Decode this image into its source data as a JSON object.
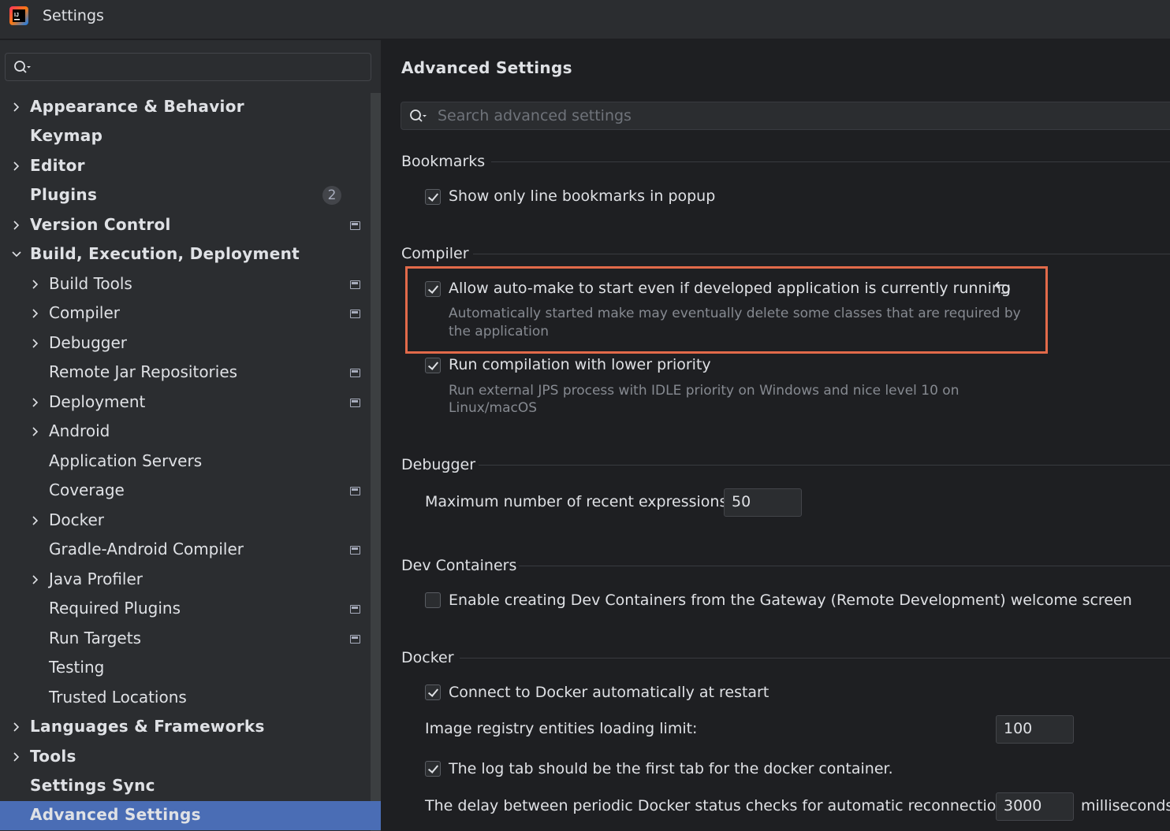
{
  "window": {
    "title": "Settings"
  },
  "sidebar": {
    "search_value": "",
    "items": [
      {
        "label": "Appearance & Behavior"
      },
      {
        "label": "Keymap"
      },
      {
        "label": "Editor"
      },
      {
        "label": "Plugins",
        "badge": "2"
      },
      {
        "label": "Version Control"
      },
      {
        "label": "Build, Execution, Deployment"
      },
      {
        "label": "Build Tools"
      },
      {
        "label": "Compiler"
      },
      {
        "label": "Debugger"
      },
      {
        "label": "Remote Jar Repositories"
      },
      {
        "label": "Deployment"
      },
      {
        "label": "Android"
      },
      {
        "label": "Application Servers"
      },
      {
        "label": "Coverage"
      },
      {
        "label": "Docker"
      },
      {
        "label": "Gradle-Android Compiler"
      },
      {
        "label": "Java Profiler"
      },
      {
        "label": "Required Plugins"
      },
      {
        "label": "Run Targets"
      },
      {
        "label": "Testing"
      },
      {
        "label": "Trusted Locations"
      },
      {
        "label": "Languages & Frameworks"
      },
      {
        "label": "Tools"
      },
      {
        "label": "Settings Sync"
      },
      {
        "label": "Advanced Settings"
      }
    ]
  },
  "main": {
    "title": "Advanced Settings",
    "search_placeholder": "Search advanced settings",
    "sections": {
      "bookmarks": {
        "title": "Bookmarks",
        "opt1": {
          "label": "Show only line bookmarks in popup",
          "checked": true
        }
      },
      "compiler": {
        "title": "Compiler",
        "opt1": {
          "label": "Allow auto-make to start even if developed application is currently running",
          "desc1": "Automatically started make may eventually delete some classes that are required by",
          "desc2": "the application",
          "checked": true
        },
        "opt2": {
          "label": "Run compilation with lower priority",
          "desc1": "Run external JPS process with IDLE priority on Windows and nice level 10 on",
          "desc2": "Linux/macOS",
          "checked": true
        }
      },
      "debugger": {
        "title": "Debugger",
        "max_label": "Maximum number of recent expressions:",
        "max_value": "50"
      },
      "dev_containers": {
        "title": "Dev Containers",
        "opt1": {
          "label": "Enable creating Dev Containers from the Gateway (Remote Development) welcome screen",
          "checked": false
        }
      },
      "docker": {
        "title": "Docker",
        "opt1": {
          "label": "Connect to Docker automatically at restart",
          "checked": true
        },
        "limit_label": "Image registry entities loading limit:",
        "limit_value": "100",
        "opt2": {
          "label": "The log tab should be the first tab for the docker container.",
          "checked": true
        },
        "delay_label": "The delay between periodic Docker status checks for automatic reconnection:",
        "delay_value": "3000",
        "delay_unit": "milliseconds"
      }
    }
  },
  "colors": {
    "selection": "#4a6db5",
    "highlight_border": "#e26a4a",
    "panel": "#2b2d30",
    "background": "#1e1f22"
  }
}
